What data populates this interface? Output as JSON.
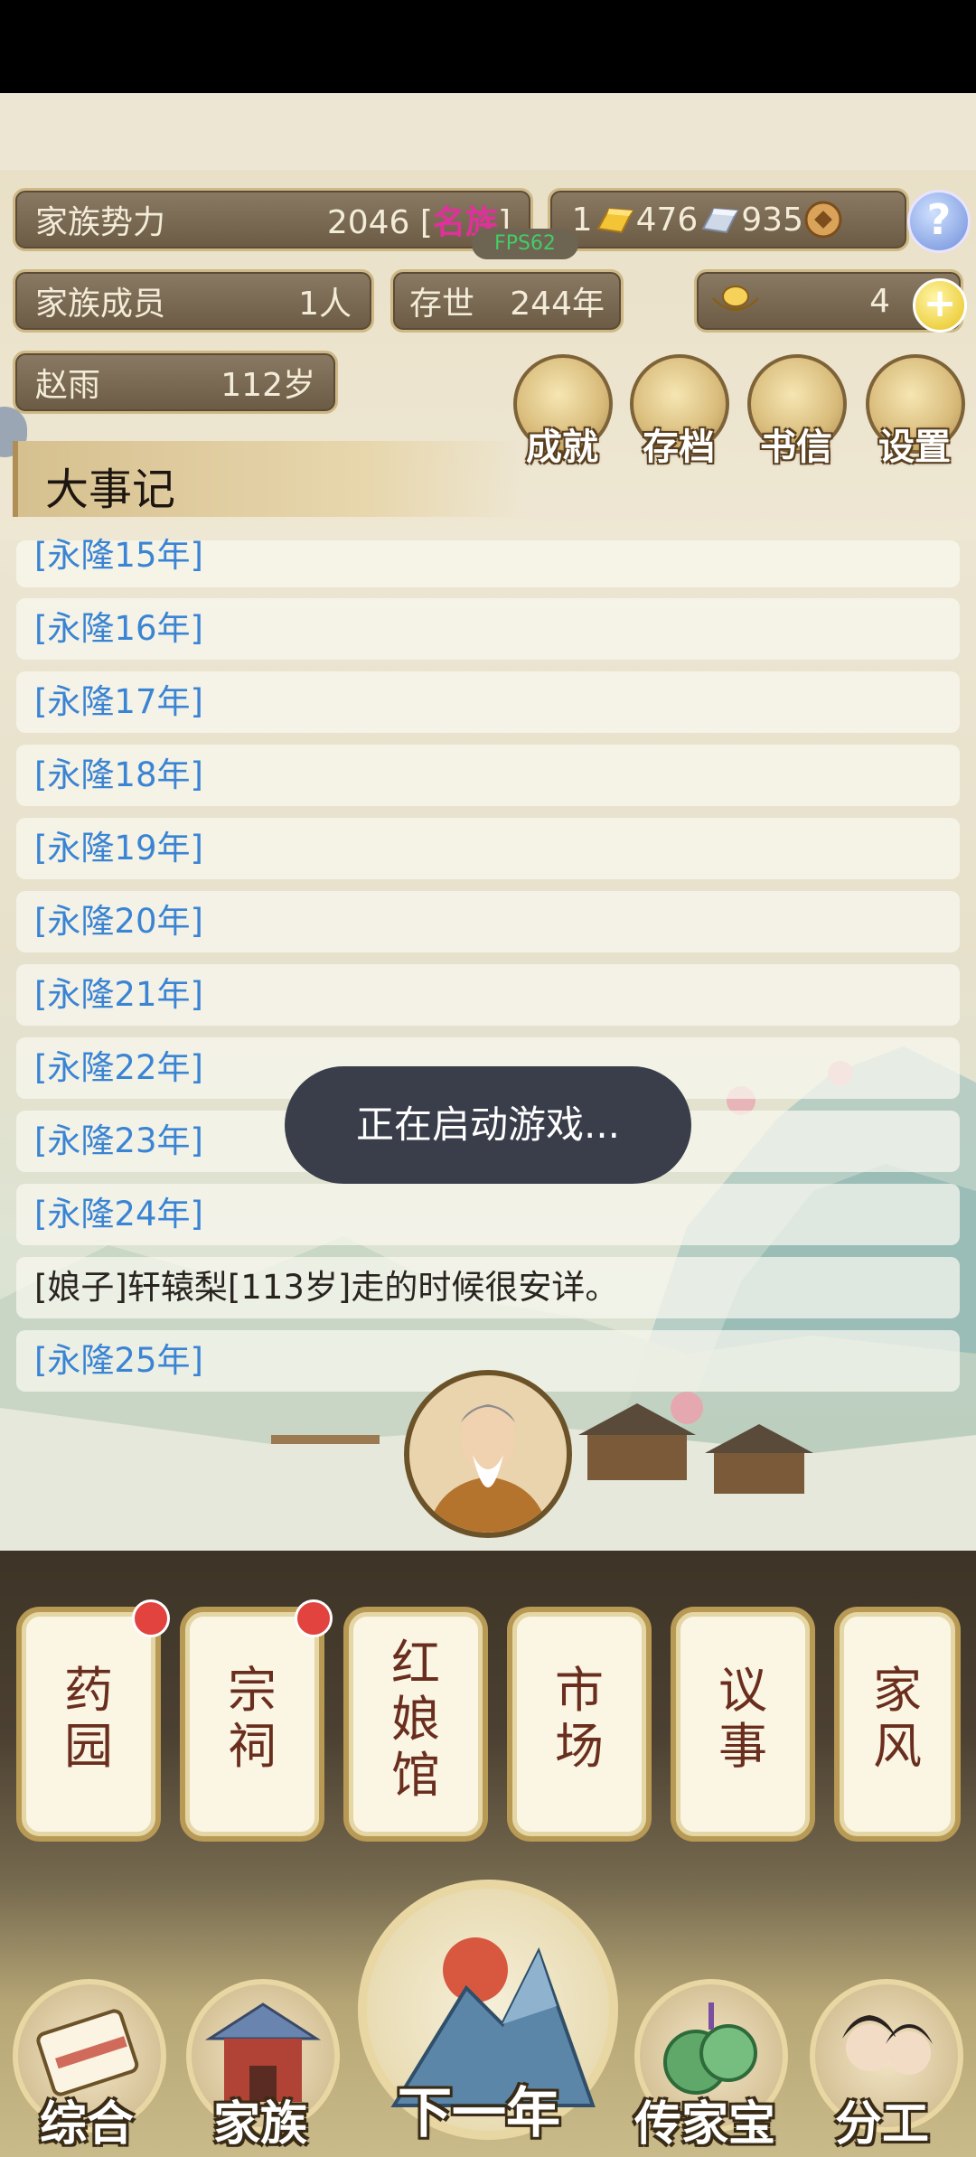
{
  "hud": {
    "power_label": "家族势力",
    "power_value": "2046",
    "power_bracket_open": "[",
    "power_rank": "名族",
    "power_bracket_close": "]",
    "fps": "FPS62",
    "gold_count": "1",
    "silver_count": "476",
    "copper_count": "935",
    "help_label": "?",
    "members_label": "家族成员",
    "members_value": "1人",
    "existence_label": "存世",
    "existence_value": "244年",
    "ingot_count": "4",
    "plus_label": "+",
    "person_name": "赵雨",
    "person_age": "112岁",
    "buttons": [
      "成就",
      "存档",
      "书信",
      "设置"
    ],
    "banner_title": "大事记"
  },
  "events": [
    {
      "text": "[永隆15年]",
      "kind": "year"
    },
    {
      "text": "[永隆16年]",
      "kind": "year"
    },
    {
      "text": "[永隆17年]",
      "kind": "year"
    },
    {
      "text": "[永隆18年]",
      "kind": "year"
    },
    {
      "text": "[永隆19年]",
      "kind": "year"
    },
    {
      "text": "[永隆20年]",
      "kind": "year"
    },
    {
      "text": "[永隆21年]",
      "kind": "year"
    },
    {
      "text": "[永隆22年]",
      "kind": "year"
    },
    {
      "text": "[永隆23年]",
      "kind": "year"
    },
    {
      "text": "[永隆24年]",
      "kind": "year"
    },
    {
      "text": "[娘子]轩辕梨[113岁]走的时候很安详。",
      "kind": "event"
    },
    {
      "text": "[永隆25年]",
      "kind": "year"
    }
  ],
  "toast": "正在启动游戏...",
  "cards": [
    {
      "label": "药\n园",
      "badge": true
    },
    {
      "label": "宗\n祠",
      "badge": true
    },
    {
      "label": "红\n娘\n馆",
      "badge": false
    },
    {
      "label": "市\n场",
      "badge": false
    },
    {
      "label": "议\n事",
      "badge": false
    },
    {
      "label": "家\n风",
      "badge": false
    }
  ],
  "nav": [
    "综合",
    "家族",
    "下一年",
    "传家宝",
    "分工"
  ],
  "colors": {
    "rank": "#e0309b",
    "year_text": "#3a84d4",
    "toast_bg": "#3a3d4a"
  }
}
